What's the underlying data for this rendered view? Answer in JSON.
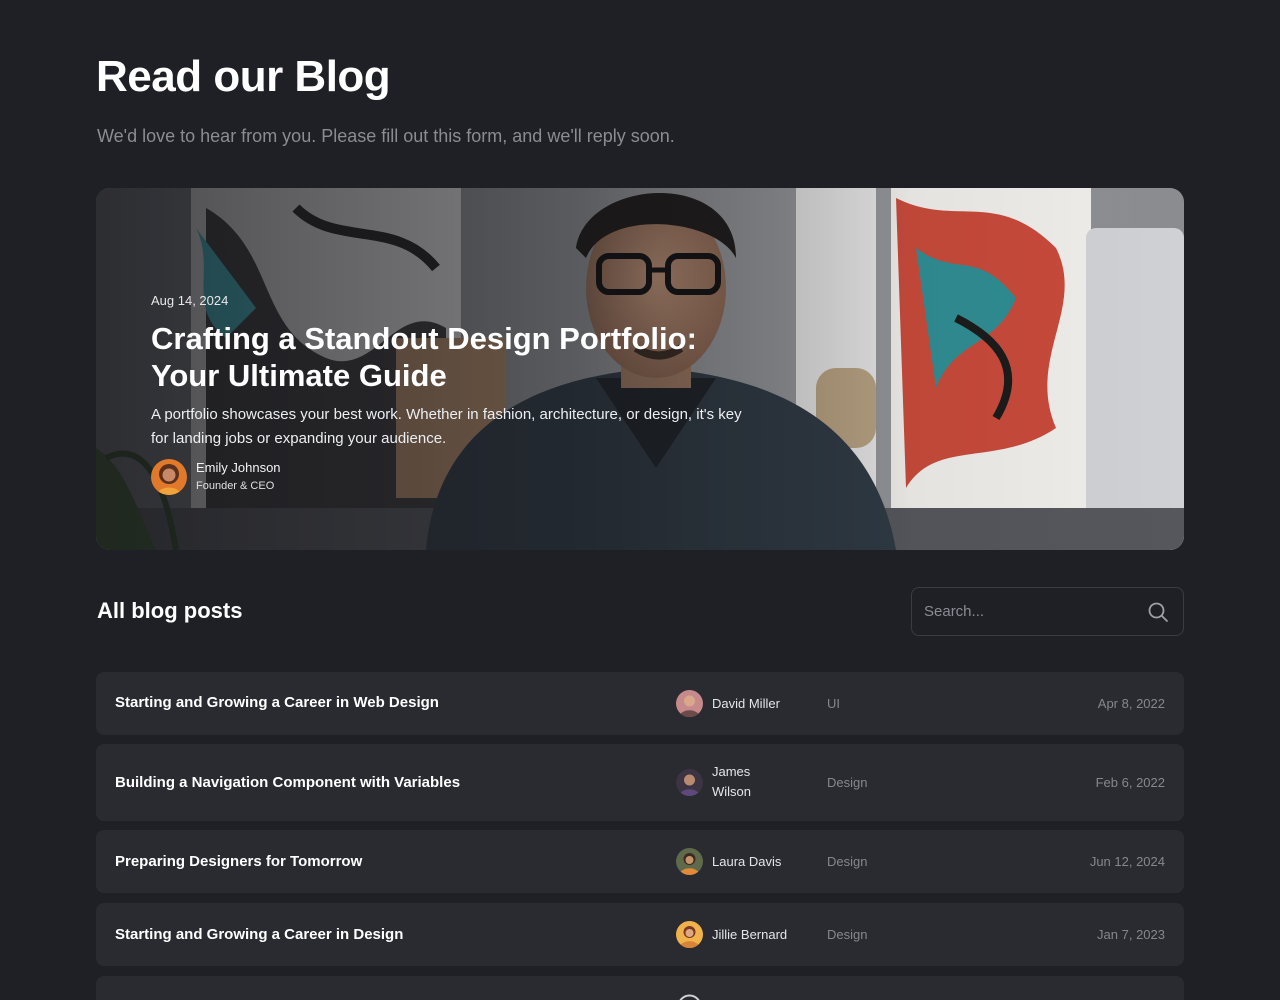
{
  "page": {
    "title": "Read our Blog",
    "subtitle": "We'd love to hear from you. Please fill out this form, and we'll reply soon."
  },
  "featured": {
    "date": "Aug 14, 2024",
    "title": "Crafting a Standout Design Portfolio: Your Ultimate Guide",
    "description": "A portfolio showcases your best work. Whether in fashion, architecture, or design, it's key for landing jobs or expanding your audience.",
    "author": {
      "name": "Emily Johnson",
      "role": "Founder & CEO"
    }
  },
  "posts_section": {
    "title": "All blog posts",
    "search_placeholder": "Search...",
    "search_icon": "search-icon"
  },
  "posts": [
    {
      "title": "Starting and Growing a Career in Web Design",
      "author": "David Miller",
      "category": "UI",
      "date": "Apr 8, 2022"
    },
    {
      "title": "Building a Navigation Component with Variables",
      "author": "James Wilson",
      "category": "Design",
      "date": "Feb 6, 2022"
    },
    {
      "title": "Preparing Designers for Tomorrow",
      "author": "Laura Davis",
      "category": "Design",
      "date": "Jun 12, 2024"
    },
    {
      "title": "Starting and Growing a Career in Design",
      "author": "Jillie Bernard",
      "category": "Design",
      "date": "Jan 7, 2023"
    }
  ],
  "colors": {
    "background": "#1f2025",
    "row_background": "#2a2b31",
    "muted_text": "#85878f"
  }
}
